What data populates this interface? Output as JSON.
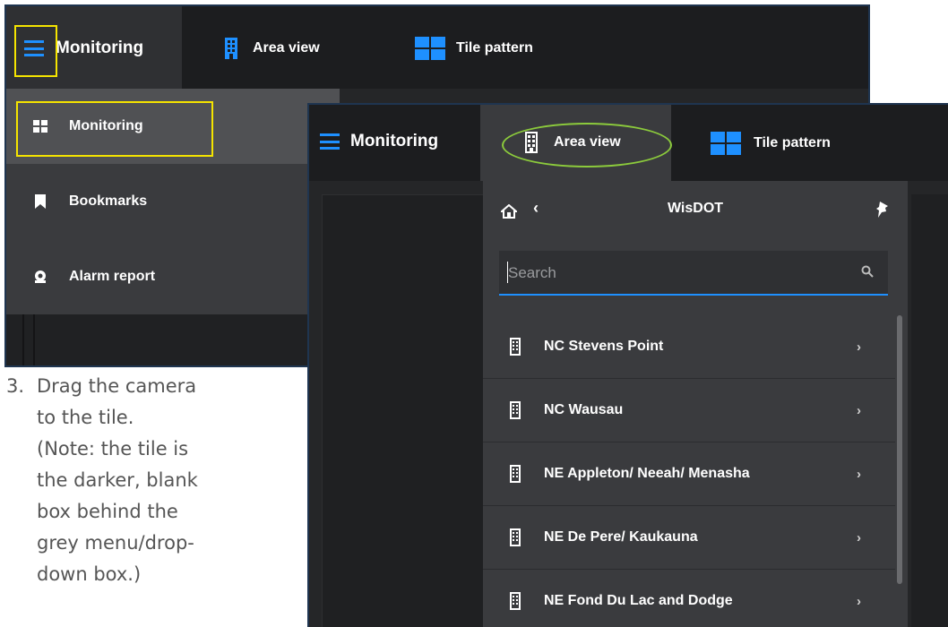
{
  "back_screenshot": {
    "header": {
      "title": "Monitoring",
      "tabs": [
        {
          "label": "Area view",
          "icon": "building-icon"
        },
        {
          "label": "Tile pattern",
          "icon": "tile-grid-icon"
        }
      ]
    },
    "menu": {
      "items": [
        {
          "label": "Monitoring",
          "icon": "tile-grid-icon",
          "active": true
        },
        {
          "label": "Bookmarks",
          "icon": "bookmark-icon",
          "active": false
        },
        {
          "label": "Alarm report",
          "icon": "alarm-icon",
          "active": false
        }
      ]
    }
  },
  "instruction": {
    "number": "3.",
    "lines": [
      "Drag the camera",
      "to the tile.",
      "(Note: the tile is",
      "the darker, blank",
      "box behind the",
      "grey menu/drop-",
      "down box.)"
    ]
  },
  "front_screenshot": {
    "header": {
      "title": "Monitoring",
      "tabs": [
        {
          "label": "Area view",
          "icon": "building-icon",
          "selected": true
        },
        {
          "label": "Tile pattern",
          "icon": "tile-grid-icon"
        }
      ]
    },
    "dropdown": {
      "title": "WisDOT",
      "search_placeholder": "Search",
      "items": [
        {
          "label": "NC Stevens Point"
        },
        {
          "label": "NC Wausau"
        },
        {
          "label": "NE Appleton/ Neeah/ Menasha"
        },
        {
          "label": "NE De Pere/ Kaukauna"
        },
        {
          "label": "NE Fond Du Lac and Dodge"
        }
      ]
    }
  },
  "colors": {
    "accent": "#1e90ff",
    "highlight_yellow": "#f5e400",
    "highlight_green": "#8ccb3c"
  }
}
